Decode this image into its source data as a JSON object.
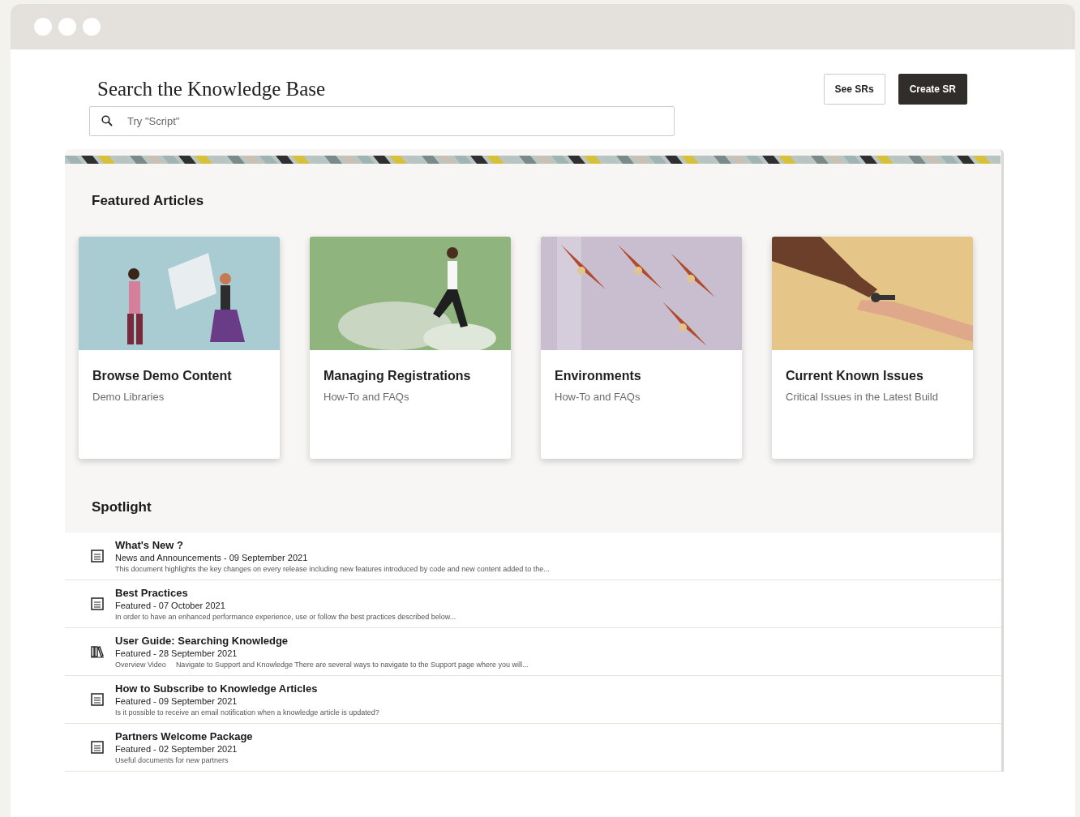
{
  "header": {
    "title": "Search the Knowledge Base",
    "buttons": [
      {
        "label": "See SRs",
        "kind": "outline"
      },
      {
        "label": "Create SR",
        "kind": "dark"
      }
    ]
  },
  "search": {
    "placeholder": "Try \"Script\""
  },
  "featured": {
    "heading": "Featured Articles",
    "cards": [
      {
        "title": "Browse Demo Content",
        "subtitle": "Demo Libraries"
      },
      {
        "title": "Managing Registrations",
        "subtitle": "How-To and FAQs"
      },
      {
        "title": "Environments",
        "subtitle": "How-To and FAQs"
      },
      {
        "title": "Current Known Issues",
        "subtitle": "Critical Issues in the Latest Build"
      }
    ]
  },
  "spotlight": {
    "heading": "Spotlight",
    "items": [
      {
        "kind": "document",
        "title": "What's New ?",
        "meta": "News and Announcements - 09 September 2021",
        "description": "This document highlights the key changes on every release including new features introduced by code and new content added to the..."
      },
      {
        "kind": "document",
        "title": "Best Practices",
        "meta": "Featured - 07 October 2021",
        "description": "In order to have an enhanced performance experience, use or follow the best practices described below..."
      },
      {
        "kind": "book",
        "title": "User Guide: Searching Knowledge",
        "meta": "Featured - 28 September 2021",
        "label": "Overview Video",
        "description": "Navigate to Support and Knowledge There are several ways to navigate to the Support page where you will..."
      },
      {
        "kind": "document",
        "title": "How to Subscribe to Knowledge Articles",
        "meta": "Featured - 09 September 2021",
        "description": "Is it possible to receive an email notification when a  knowledge article is updated?"
      },
      {
        "kind": "document",
        "title": "Partners Welcome Package",
        "meta": "Featured - 02 September 2021",
        "description": "Useful documents for new partners"
      }
    ]
  }
}
